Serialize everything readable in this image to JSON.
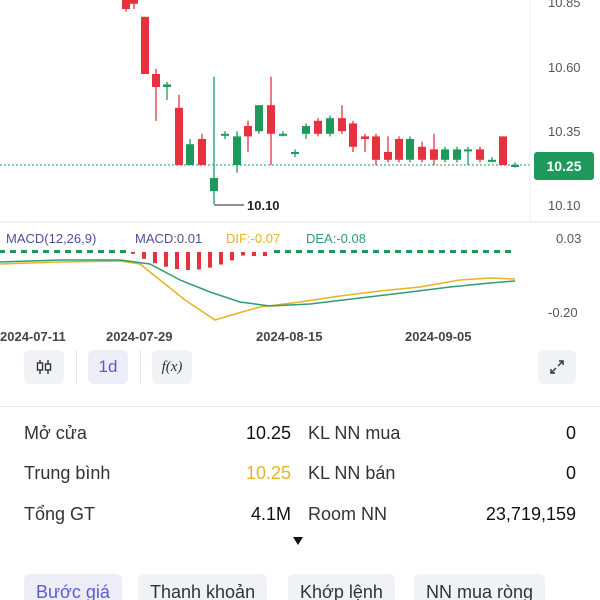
{
  "chart": {
    "y_axis_labels": [
      "10.85",
      "10.60",
      "10.35",
      "10.10"
    ],
    "last_price": "10.25",
    "min_label": "10.10",
    "macd_header": {
      "macd_name": "MACD(12,26,9)",
      "macd_value": "MACD:0.01",
      "dif_value": "DIF:-0.07",
      "dea_value": "DEA:-0.08"
    },
    "macd_axis_labels": [
      "0.03",
      "-0.20"
    ],
    "date_labels": [
      "2024-07-11",
      "2024-07-29",
      "2024-08-15",
      "2024-09-05"
    ],
    "colors": {
      "up": "#1d9a5b",
      "down": "#e5323e",
      "dif": "#e6b422",
      "dea": "#2e9d74"
    }
  },
  "toolbar": {
    "candle_icon": "candlestick-icon",
    "interval_label": "1d",
    "function_label": "f(x)",
    "expand_icon": "expand-icon"
  },
  "info": {
    "open_label": "Mở cửa",
    "open_value": "10.25",
    "avg_label": "Trung bình",
    "avg_value": "10.25",
    "total_label": "Tổng GT",
    "total_value": "4.1M",
    "nn_buy_label": "KL NN mua",
    "nn_buy_value": "0",
    "nn_sell_label": "KL NN bán",
    "nn_sell_value": "0",
    "room_label": "Room NN",
    "room_value": "23,719,159"
  },
  "tabs": [
    "Bước giá",
    "Thanh khoản",
    "Khớp lệnh",
    "NN mua ròng"
  ]
}
